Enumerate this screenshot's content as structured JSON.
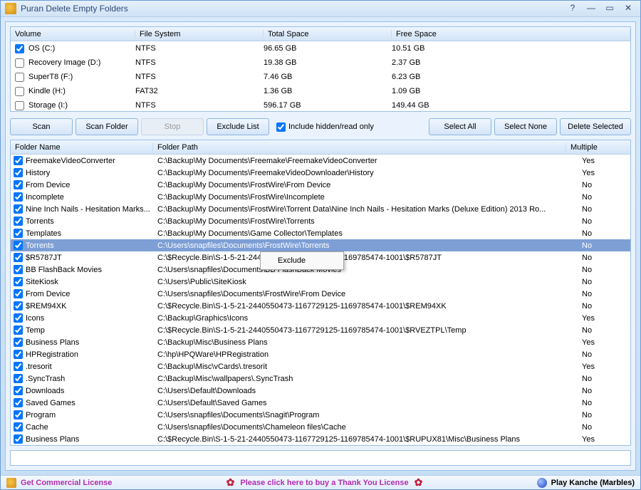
{
  "window": {
    "title": "Puran Delete Empty Folders"
  },
  "volumes": {
    "headers": {
      "volume": "Volume",
      "fs": "File System",
      "total": "Total Space",
      "free": "Free Space"
    },
    "rows": [
      {
        "checked": true,
        "name": "OS (C:)",
        "fs": "NTFS",
        "total": "96.65 GB",
        "free": "10.51 GB"
      },
      {
        "checked": false,
        "name": "Recovery Image (D:)",
        "fs": "NTFS",
        "total": "19.38 GB",
        "free": "2.37 GB"
      },
      {
        "checked": false,
        "name": "SuperT8 (F:)",
        "fs": "NTFS",
        "total": "7.46 GB",
        "free": "6.23 GB"
      },
      {
        "checked": false,
        "name": "Kindle (H:)",
        "fs": "FAT32",
        "total": "1.36 GB",
        "free": "1.09 GB"
      },
      {
        "checked": false,
        "name": "Storage (I:)",
        "fs": "NTFS",
        "total": "596.17 GB",
        "free": "149.44 GB"
      }
    ]
  },
  "toolbar": {
    "scan": "Scan",
    "scan_folder": "Scan Folder",
    "stop": "Stop",
    "exclude_list": "Exclude List",
    "include_hidden_label": "Include hidden/read only",
    "include_hidden_checked": true,
    "select_all": "Select All",
    "select_none": "Select None",
    "delete_selected": "Delete Selected"
  },
  "results": {
    "headers": {
      "name": "Folder Name",
      "path": "Folder Path",
      "multiple": "Multiple"
    },
    "selected_index": 7,
    "rows": [
      {
        "checked": true,
        "name": "FreemakeVideoConverter",
        "path": "C:\\Backup\\My Documents\\Freemake\\FreemakeVideoConverter",
        "multiple": "Yes"
      },
      {
        "checked": true,
        "name": "History",
        "path": "C:\\Backup\\My Documents\\FreemakeVideoDownloader\\History",
        "multiple": "Yes"
      },
      {
        "checked": true,
        "name": "From Device",
        "path": "C:\\Backup\\My Documents\\FrostWire\\From Device",
        "multiple": "No"
      },
      {
        "checked": true,
        "name": "Incomplete",
        "path": "C:\\Backup\\My Documents\\FrostWire\\Incomplete",
        "multiple": "No"
      },
      {
        "checked": true,
        "name": "Nine Inch Nails - Hesitation Marks...",
        "path": "C:\\Backup\\My Documents\\FrostWire\\Torrent Data\\Nine Inch Nails - Hesitation Marks (Deluxe Edition) 2013 Ro...",
        "multiple": "No"
      },
      {
        "checked": true,
        "name": "Torrents",
        "path": "C:\\Backup\\My Documents\\FrostWire\\Torrents",
        "multiple": "No"
      },
      {
        "checked": true,
        "name": "Templates",
        "path": "C:\\Backup\\My Documents\\Game Collector\\Templates",
        "multiple": "No"
      },
      {
        "checked": true,
        "name": "Torrents",
        "path": "C:\\Users\\snapfiles\\Documents\\FrostWire\\Torrents",
        "multiple": "No"
      },
      {
        "checked": true,
        "name": "$R5787JT",
        "path": "C:\\$Recycle.Bin\\S-1-5-21-2440550473-1167729125-1169785474-1001\\$R5787JT",
        "multiple": "No"
      },
      {
        "checked": true,
        "name": "BB FlashBack Movies",
        "path": "C:\\Users\\snapfiles\\Documents\\BB FlashBack Movies",
        "multiple": "No"
      },
      {
        "checked": true,
        "name": "SiteKiosk",
        "path": "C:\\Users\\Public\\SiteKiosk",
        "multiple": "No"
      },
      {
        "checked": true,
        "name": "From Device",
        "path": "C:\\Users\\snapfiles\\Documents\\FrostWire\\From Device",
        "multiple": "No"
      },
      {
        "checked": true,
        "name": "$REM94XK",
        "path": "C:\\$Recycle.Bin\\S-1-5-21-2440550473-1167729125-1169785474-1001\\$REM94XK",
        "multiple": "No"
      },
      {
        "checked": true,
        "name": "Icons",
        "path": "C:\\Backup\\Graphics\\Icons",
        "multiple": "Yes"
      },
      {
        "checked": true,
        "name": "Temp",
        "path": "C:\\$Recycle.Bin\\S-1-5-21-2440550473-1167729125-1169785474-1001\\$RVEZTPL\\Temp",
        "multiple": "No"
      },
      {
        "checked": true,
        "name": "Business Plans",
        "path": "C:\\Backup\\Misc\\Business Plans",
        "multiple": "Yes"
      },
      {
        "checked": true,
        "name": "HPRegistration",
        "path": "C:\\hp\\HPQWare\\HPRegistration",
        "multiple": "No"
      },
      {
        "checked": true,
        "name": ".tresorit",
        "path": "C:\\Backup\\Misc\\vCards\\.tresorit",
        "multiple": "Yes"
      },
      {
        "checked": true,
        "name": ".SyncTrash",
        "path": "C:\\Backup\\Misc\\wallpapers\\.SyncTrash",
        "multiple": "No"
      },
      {
        "checked": true,
        "name": "Downloads",
        "path": "C:\\Users\\Default\\Downloads",
        "multiple": "No"
      },
      {
        "checked": true,
        "name": "Saved Games",
        "path": "C:\\Users\\Default\\Saved Games",
        "multiple": "No"
      },
      {
        "checked": true,
        "name": "Program",
        "path": "C:\\Users\\snapfiles\\Documents\\Snagit\\Program",
        "multiple": "No"
      },
      {
        "checked": true,
        "name": "Cache",
        "path": "C:\\Users\\snapfiles\\Documents\\Chameleon files\\Cache",
        "multiple": "No"
      },
      {
        "checked": true,
        "name": "Business Plans",
        "path": "C:\\$Recycle.Bin\\S-1-5-21-2440550473-1167729125-1169785474-1001\\$RUPUX81\\Misc\\Business Plans",
        "multiple": "Yes"
      }
    ]
  },
  "context_menu": {
    "exclude": "Exclude"
  },
  "footer": {
    "commercial": "Get Commercial License",
    "thankyou": "Please click here to buy a Thank You License",
    "play": "Play Kanche (Marbles)"
  }
}
